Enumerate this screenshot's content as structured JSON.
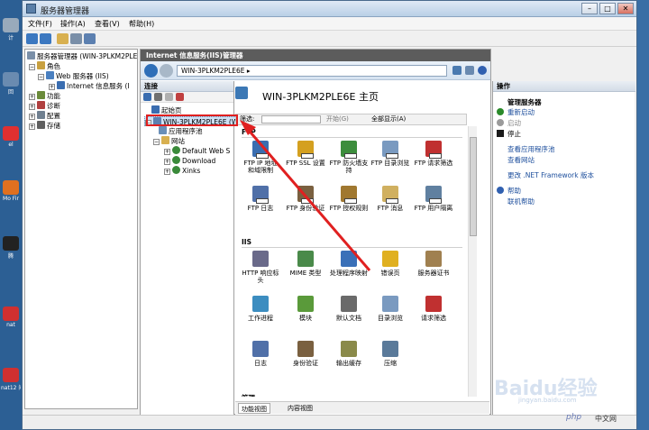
{
  "window": {
    "title": "服务器管理器"
  },
  "menu": [
    "文件(F)",
    "操作(A)",
    "查看(V)",
    "帮助(H)"
  ],
  "tree": {
    "items": [
      {
        "label": "服务器管理器 (WIN-3PLKM2PLE6I",
        "level": 0
      },
      {
        "label": "角色",
        "level": 1
      },
      {
        "label": "Web 服务器 (IIS)",
        "level": 2
      },
      {
        "label": "Internet 信息服务 (I",
        "level": 3
      },
      {
        "label": "功能",
        "level": 1
      },
      {
        "label": "诊断",
        "level": 1
      },
      {
        "label": "配置",
        "level": 1
      },
      {
        "label": "存储",
        "level": 1
      }
    ]
  },
  "iis": {
    "header": "Internet 信息服务(IIS)管理器",
    "breadcrumb": "WIN-3PLKM2PLE6E ▸",
    "connections": {
      "title": "连接",
      "items": [
        {
          "label": "起始页",
          "level": 0
        },
        {
          "label": "WIN-3PLKM2PLE6E (WIN",
          "level": 0,
          "selected": true
        },
        {
          "label": "应用程序池",
          "level": 1
        },
        {
          "label": "网站",
          "level": 1
        },
        {
          "label": "Default Web S",
          "level": 2
        },
        {
          "label": "Download",
          "level": 2
        },
        {
          "label": "Xinks",
          "level": 2
        }
      ]
    },
    "home_title": "WIN-3PLKM2PLE6E 主页",
    "filter": {
      "label": "筛选:",
      "go": "开始(G)",
      "show_all": "全部显示(A)"
    },
    "groups": [
      {
        "name": "FTP",
        "features": [
          {
            "label": "FTP IP 地址和域限制",
            "icon": "ftp-ip-icon",
            "color": "#3a6db0"
          },
          {
            "label": "FTP SSL 设置",
            "icon": "ftp-ssl-icon",
            "color": "#d4a020"
          },
          {
            "label": "FTP 防火墙支持",
            "icon": "ftp-firewall-icon",
            "color": "#3c8d3c"
          },
          {
            "label": "FTP 目录浏览",
            "icon": "ftp-dir-icon",
            "color": "#7a9ac0"
          },
          {
            "label": "FTP 请求筛选",
            "icon": "ftp-filter-icon",
            "color": "#c03030"
          },
          {
            "label": "FTP 日志",
            "icon": "ftp-log-icon",
            "color": "#5070a8"
          },
          {
            "label": "FTP 身份验证",
            "icon": "ftp-auth-icon",
            "color": "#7a6040"
          },
          {
            "label": "FTP 授权规则",
            "icon": "ftp-authz-icon",
            "color": "#a07830"
          },
          {
            "label": "FTP 消息",
            "icon": "ftp-message-icon",
            "color": "#d0b060"
          },
          {
            "label": "FTP 用户隔离",
            "icon": "ftp-isolation-icon",
            "color": "#6080a0"
          }
        ]
      },
      {
        "name": "IIS",
        "features": [
          {
            "label": "HTTP 响应标头",
            "icon": "http-headers-icon",
            "color": "#6a6a8a"
          },
          {
            "label": "MIME 类型",
            "icon": "mime-icon",
            "color": "#4a8a4a"
          },
          {
            "label": "处理程序映射",
            "icon": "handler-icon",
            "color": "#3a70b8"
          },
          {
            "label": "错误页",
            "icon": "error-page-icon",
            "color": "#e0b020"
          },
          {
            "label": "服务器证书",
            "icon": "cert-icon",
            "color": "#a08050"
          },
          {
            "label": "工作进程",
            "icon": "worker-icon",
            "color": "#3c8dc0"
          },
          {
            "label": "模块",
            "icon": "module-icon",
            "color": "#5a9a3a"
          },
          {
            "label": "默认文档",
            "icon": "default-doc-icon",
            "color": "#6a6a6a"
          },
          {
            "label": "目录浏览",
            "icon": "dir-browse-icon",
            "color": "#7a9ac0"
          },
          {
            "label": "请求筛选",
            "icon": "request-filter-icon",
            "color": "#c03030"
          },
          {
            "label": "日志",
            "icon": "log-icon",
            "color": "#5070a8"
          },
          {
            "label": "身份验证",
            "icon": "auth-icon",
            "color": "#7a6040"
          },
          {
            "label": "输出缓存",
            "icon": "output-cache-icon",
            "color": "#8a8a4a"
          },
          {
            "label": "压缩",
            "icon": "compress-icon",
            "color": "#5a7a9a"
          }
        ]
      },
      {
        "name": "管理",
        "features": []
      }
    ],
    "view_tabs": [
      "功能视图",
      "内容视图"
    ]
  },
  "actions": {
    "title": "操作",
    "items": [
      {
        "label": "管理服务器",
        "type": "heading"
      },
      {
        "label": "重新启动",
        "type": "link",
        "icon_color": "#2a8a2a"
      },
      {
        "label": "启动",
        "type": "disabled",
        "icon_color": "#9a9a9a"
      },
      {
        "label": "停止",
        "type": "link",
        "icon_color": "#1a1a1a"
      },
      {
        "label": "查看应用程序池",
        "type": "link"
      },
      {
        "label": "查看网站",
        "type": "link"
      },
      {
        "label": "更改 .NET Framework 版本",
        "type": "link"
      },
      {
        "label": "帮助",
        "type": "link",
        "icon_color": "#3060b0"
      },
      {
        "label": "联机帮助",
        "type": "link"
      }
    ]
  },
  "desktop": {
    "labels": [
      "计",
      "回",
      "el",
      "Mo\nFir",
      "腾",
      "nat",
      "nat12\n问"
    ]
  },
  "watermark": {
    "main": "Baidu经验",
    "sub": "jingyan.baidu.com",
    "php": "php",
    "site": "中文网"
  }
}
